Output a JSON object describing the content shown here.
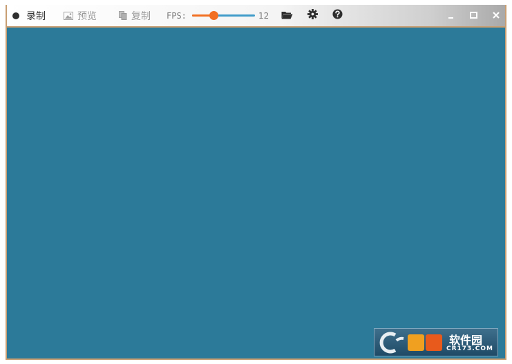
{
  "toolbar": {
    "record_label": "录制",
    "preview_label": "预览",
    "copy_label": "复制",
    "fps_label": "FPS:",
    "fps_value": "12",
    "fps_fraction": 0.34
  },
  "watermark": {
    "brand_cn": "软件园",
    "domain": "CR173.COM"
  },
  "colors": {
    "canvas": "#2c7a99",
    "accent": "#f26f21",
    "slider_track": "#3f9bc9",
    "frame_border": "#c89e72"
  },
  "icons": {
    "record": "record-dot-icon",
    "preview": "image-icon",
    "copy": "copy-icon",
    "open": "folder-open-icon",
    "settings": "gear-icon",
    "help": "help-icon",
    "minimize": "minimize-icon",
    "maximize": "maximize-icon",
    "close": "close-icon"
  }
}
